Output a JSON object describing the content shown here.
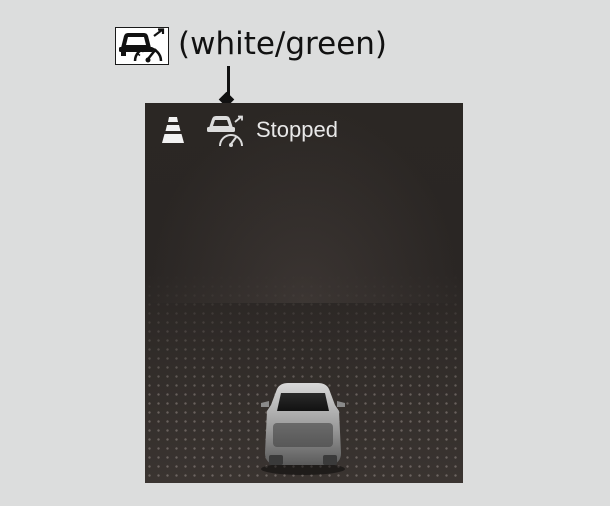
{
  "legend": {
    "icon": "acc-vehicle-gauge-icon",
    "text": "(white/green)"
  },
  "screen": {
    "status_text": "Stopped",
    "lane_icon": "lane-icon",
    "acc_icon": "acc-vehicle-gauge-icon",
    "vehicle": "own-vehicle-rear-view"
  },
  "colors": {
    "background": "#dcdddd",
    "screen": "#2b2724",
    "screen_text": "#e8e8e8",
    "ink": "#111111"
  }
}
